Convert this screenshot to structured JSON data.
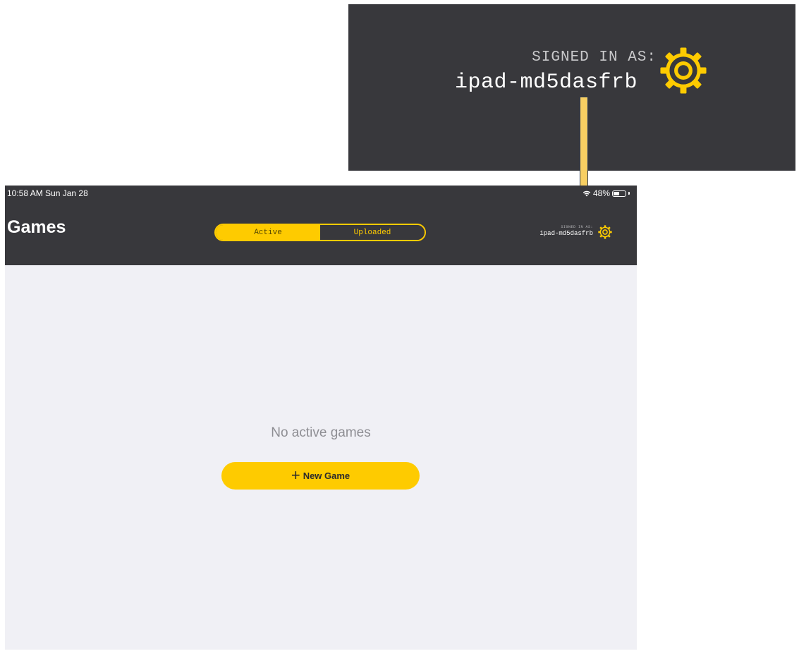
{
  "callout": {
    "signed_in_label": "SIGNED IN AS:",
    "username": "ipad-md5dasfrb",
    "icon": "gear-icon"
  },
  "status_bar": {
    "time": "10:58 AM  Sun Jan 28",
    "battery_text": "48%",
    "battery_level": 0.48,
    "wifi_icon": "wifi-icon",
    "battery_icon": "battery-icon"
  },
  "nav": {
    "title": "Games",
    "tabs": [
      {
        "label": "Active",
        "selected": true
      },
      {
        "label": "Uploaded",
        "selected": false
      }
    ],
    "signed_in_label": "SIGNED IN AS:",
    "username": "ipad-md5dasfrb",
    "settings_icon": "gear-icon"
  },
  "main": {
    "empty_message": "No active games",
    "new_game_label": "New Game",
    "new_game_icon": "plus-icon"
  },
  "colors": {
    "accent": "#fecb00",
    "nav_background": "#38383c",
    "content_background": "#f0f0f5",
    "arrow": "#f8cf62"
  }
}
